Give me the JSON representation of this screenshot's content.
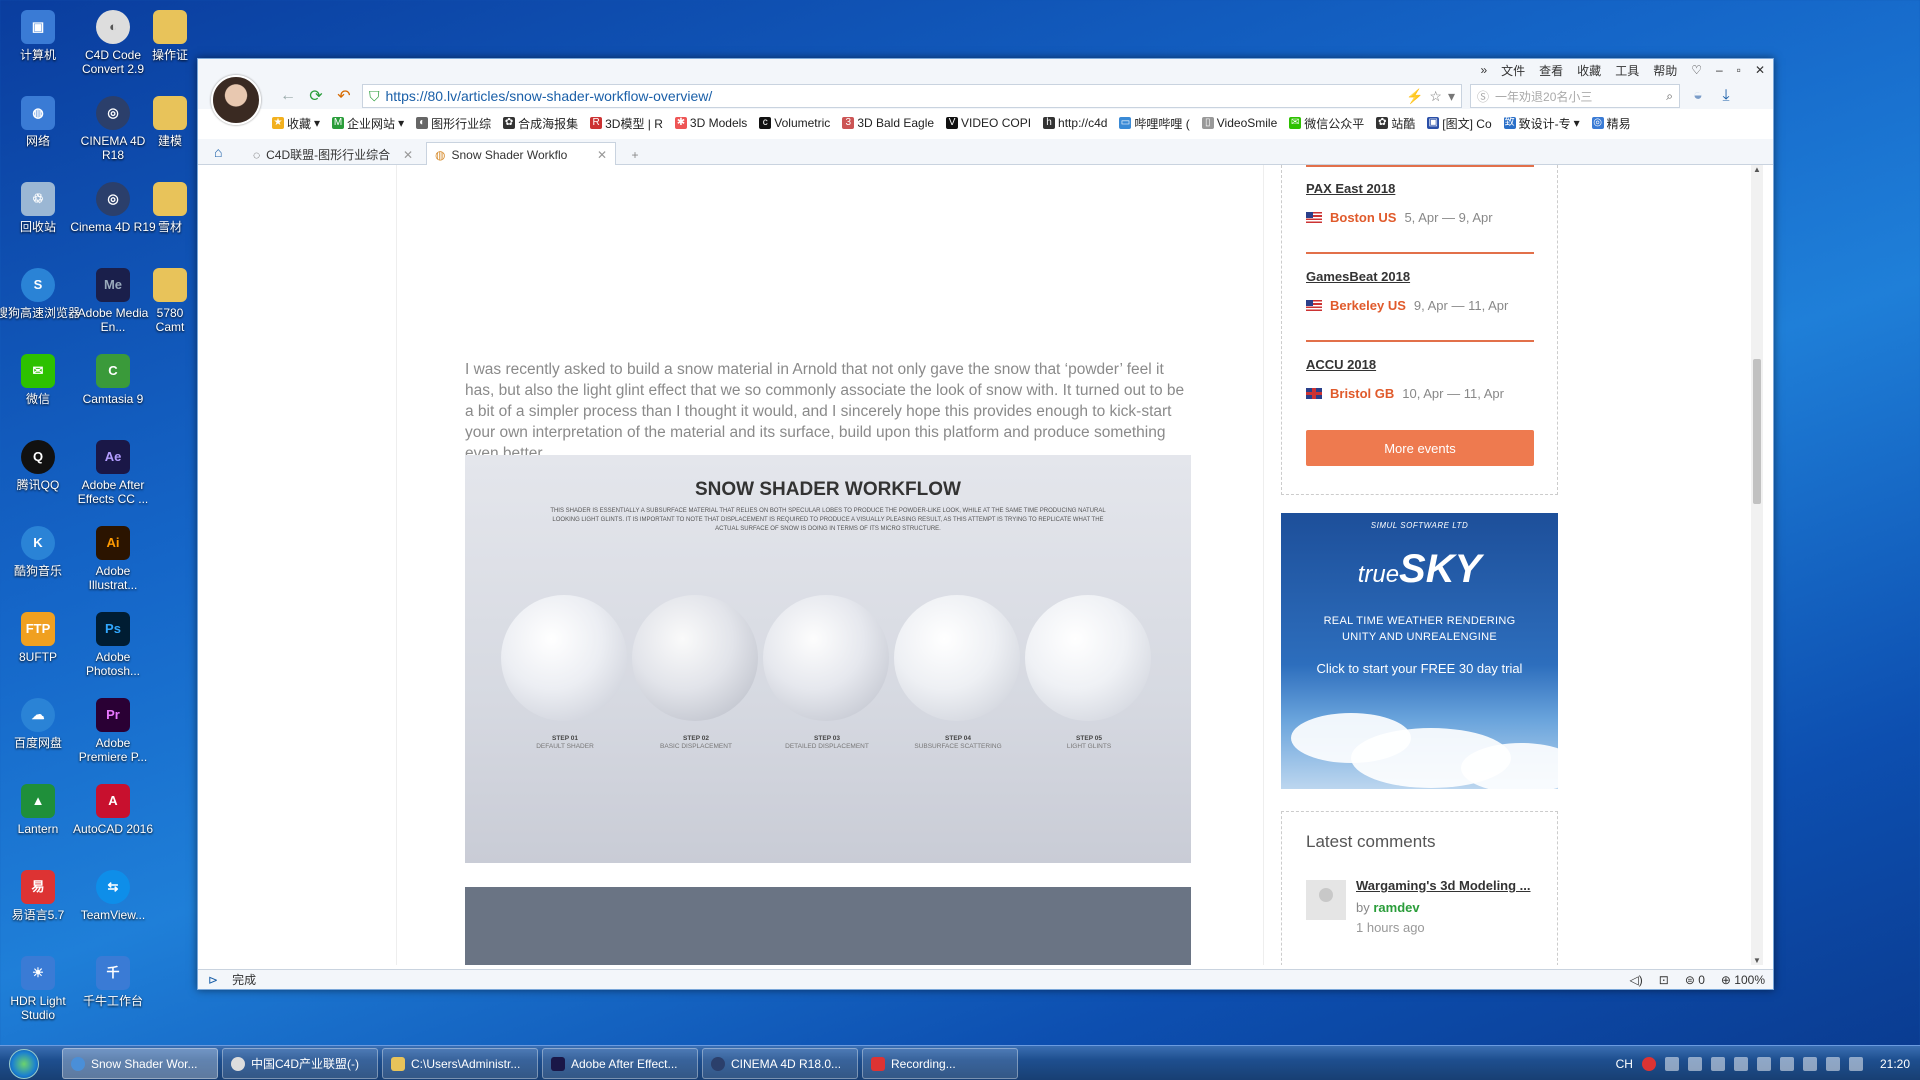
{
  "desktop": {
    "icons": [
      {
        "label": "计算机"
      },
      {
        "label": "C4D Code Convert 2.9"
      },
      {
        "label": "操作证"
      },
      {
        "label": "网络"
      },
      {
        "label": "CINEMA 4D R18"
      },
      {
        "label": "建模"
      },
      {
        "label": "回收站"
      },
      {
        "label": "Cinema 4D R19"
      },
      {
        "label": "雪材"
      },
      {
        "label": "搜狗高速浏览器"
      },
      {
        "label": "Adobe Media En..."
      },
      {
        "label": "5780 Camt"
      },
      {
        "label": "微信"
      },
      {
        "label": "Camtasia 9"
      },
      {
        "label": "腾讯QQ"
      },
      {
        "label": "Adobe After Effects CC ..."
      },
      {
        "label": "酷狗音乐"
      },
      {
        "label": "Adobe Illustrat..."
      },
      {
        "label": "8UFTP"
      },
      {
        "label": "Adobe Photosh..."
      },
      {
        "label": "百度网盘"
      },
      {
        "label": "Adobe Premiere P..."
      },
      {
        "label": "Lantern"
      },
      {
        "label": "AutoCAD 2016"
      },
      {
        "label": "易语言5.7"
      },
      {
        "label": "TeamView..."
      },
      {
        "label": "HDR Light Studio"
      },
      {
        "label": "千牛工作台"
      }
    ]
  },
  "browser": {
    "menu": [
      "文件",
      "查看",
      "收藏",
      "工具",
      "帮助"
    ],
    "url": "https://80.lv/articles/snow-shader-workflow-overview/",
    "search_placeholder": "一年劝退20名小三",
    "bookmarks": [
      "收藏",
      "企业网站",
      "图形行业综",
      "合成海报集",
      "3D模型 | R",
      "3D Models",
      "Volumetric",
      "3D Bald Eagle",
      "VIDEO COPI",
      "http://c4d",
      "哔哩哔哩 (",
      "VideoSmile",
      "微信公众平",
      "站酷",
      "[图文] Co",
      "致设计-专",
      "精易"
    ],
    "tabs": [
      {
        "label": "C4D联盟-图形行业综合"
      },
      {
        "label": "Snow Shader Workflo"
      }
    ],
    "status": "完成",
    "zoom": "100%",
    "downloads_count": "0"
  },
  "article": {
    "paragraph": "I was recently asked to build a snow material in Arnold that not only gave the snow that ‘powder’ feel it has, but also the light glint effect that we so commonly associate the look of snow with. It turned out to be a bit of a simpler process than I thought it would, and I sincerely hope this provides enough to kick-start your own interpretation of the material and its surface, build upon this platform and produce something even better.",
    "figure": {
      "title": "SNOW SHADER WORKFLOW",
      "subtitle": "THIS SHADER IS ESSENTIALLY A SUBSURFACE MATERIAL THAT RELIES ON BOTH SPECULAR LOBES TO PRODUCE THE POWDER-LIKE LOOK, WHILE AT THE SAME TIME PRODUCING NATURAL LOOKING LIGHT GLINTS. IT IS IMPORTANT TO NOTE THAT DISPLACEMENT IS REQUIRED TO PRODUCE A VISUALLY PLEASING RESULT, AS THIS ATTEMPT IS TRYING TO REPLICATE WHAT THE ACTUAL SURFACE OF SNOW IS DOING IN TERMS OF ITS MICRO STRUCTURE.",
      "steps": [
        {
          "label": "STEP 01",
          "name": "DEFAULT SHADER"
        },
        {
          "label": "STEP 02",
          "name": "BASIC DISPLACEMENT"
        },
        {
          "label": "STEP 03",
          "name": "DETAILED DISPLACEMENT"
        },
        {
          "label": "STEP 04",
          "name": "SUBSURFACE SCATTERING"
        },
        {
          "label": "STEP 05",
          "name": "LIGHT GLINTS"
        }
      ]
    }
  },
  "sidebar": {
    "events": [
      {
        "name": "PAX East 2018",
        "city": "Boston US",
        "dates": "5, Apr — 9, Apr",
        "flag": "us"
      },
      {
        "name": "GamesBeat 2018",
        "city": "Berkeley US",
        "dates": "9, Apr — 11, Apr",
        "flag": "us"
      },
      {
        "name": "ACCU 2018",
        "city": "Bristol GB",
        "dates": "10, Apr — 11, Apr",
        "flag": "gb"
      }
    ],
    "more_events": "More events",
    "ad": {
      "company": "SIMUL SOFTWARE LTD",
      "brand_1": "true",
      "brand_2": "SKY",
      "line1": "REAL TIME WEATHER RENDERING",
      "line2": "UNITY AND UNREALENGINE",
      "cta": "Click to start your FREE 30 day trial"
    },
    "comments": {
      "heading": "Latest comments",
      "item_title": "Wargaming's 3d Modeling ...",
      "by": "by",
      "author": "ramdev",
      "time": "1 hours ago"
    }
  },
  "taskbar": {
    "items": [
      {
        "label": "Snow Shader Wor..."
      },
      {
        "label": "中国C4D产业联盟(-)"
      },
      {
        "label": "C:\\Users\\Administr..."
      },
      {
        "label": "Adobe After Effect..."
      },
      {
        "label": "CINEMA 4D R18.0..."
      },
      {
        "label": "Recording..."
      }
    ],
    "lang": "CH",
    "clock": "21:20"
  },
  "colors": {
    "accent": "#ee7a4f",
    "link": "#1a5fa8",
    "event_city": "#e05a2b"
  }
}
